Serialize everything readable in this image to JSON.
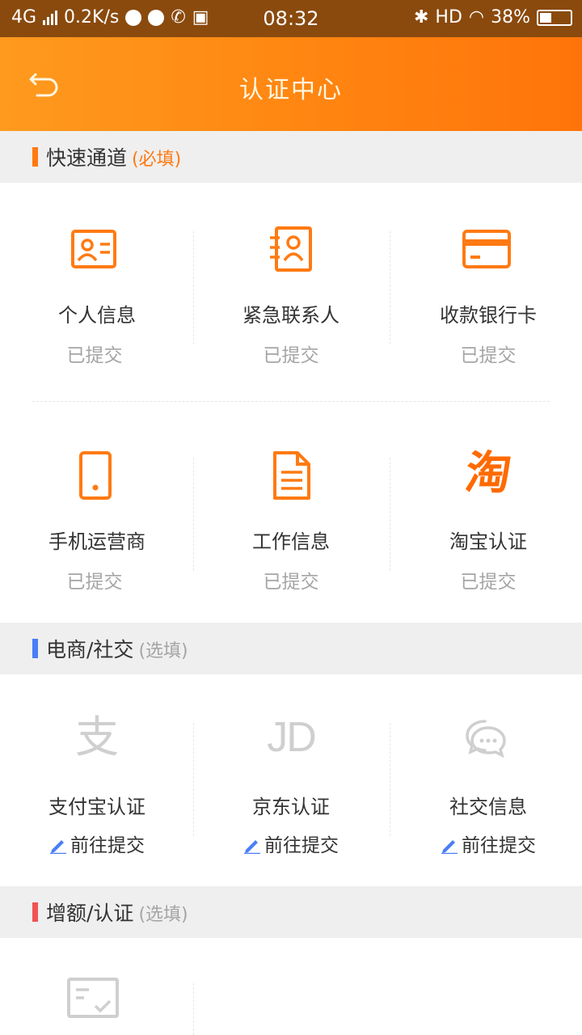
{
  "status_bar": {
    "network": "4G",
    "speed": "0.2K/s",
    "time": "08:32",
    "hd": "HD",
    "battery": "38%"
  },
  "header": {
    "title": "认证中心",
    "back_icon": "back-arrow-icon"
  },
  "sections": [
    {
      "title": "快速通道",
      "subtitle": "(必填)",
      "accent": "#ff7a12",
      "subtitle_color": "#ff7a12",
      "items": [
        {
          "label": "个人信息",
          "status": "已提交",
          "icon": "id-card-icon"
        },
        {
          "label": "紧急联系人",
          "status": "已提交",
          "icon": "contact-book-icon"
        },
        {
          "label": "收款银行卡",
          "status": "已提交",
          "icon": "bank-card-icon"
        },
        {
          "label": "手机运营商",
          "status": "已提交",
          "icon": "mobile-phone-icon"
        },
        {
          "label": "工作信息",
          "status": "已提交",
          "icon": "document-icon"
        },
        {
          "label": "淘宝认证",
          "status": "已提交",
          "icon": "taobao-icon",
          "glyph": "淘"
        }
      ]
    },
    {
      "title": "电商/社交",
      "subtitle": "(选填)",
      "accent": "#4a7ef5",
      "subtitle_color": "#a5a5a5",
      "items": [
        {
          "label": "支付宝认证",
          "action": "前往提交",
          "icon": "alipay-icon",
          "glyph": "支"
        },
        {
          "label": "京东认证",
          "action": "前往提交",
          "icon": "jd-icon",
          "glyph": "JD"
        },
        {
          "label": "社交信息",
          "action": "前往提交",
          "icon": "chat-bubble-icon"
        }
      ]
    },
    {
      "title": "增额/认证",
      "subtitle": "(选填)",
      "accent": "#f05454",
      "subtitle_color": "#a5a5a5",
      "items": [
        {
          "label": "",
          "icon": "certificate-icon"
        }
      ]
    }
  ],
  "colors": {
    "orange": "#ff7a12",
    "gray_icon": "#cfcfcf",
    "pencil": "#4a7ef5"
  }
}
